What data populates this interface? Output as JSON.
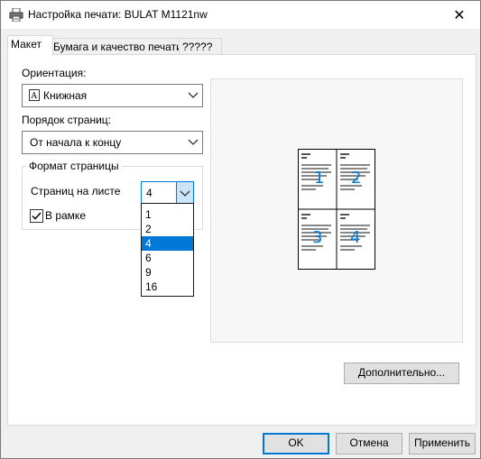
{
  "window": {
    "title": "Настройка печати: BULAT M1121nw",
    "close_glyph": "✕"
  },
  "tabs": [
    {
      "label": "Макет",
      "active": true
    },
    {
      "label": "Бумага и качество печати",
      "active": false
    },
    {
      "label": "?????",
      "active": false
    }
  ],
  "orientation": {
    "label": "Ориентация:",
    "value": "Книжная"
  },
  "page_order": {
    "label": "Порядок страниц:",
    "value": "От начала к концу"
  },
  "page_format": {
    "title": "Формат страницы",
    "pages_per_sheet_label": "Страниц на листе",
    "pages_per_sheet_value": "4",
    "border_label": "В рамке",
    "border_checked": true
  },
  "pages_dropdown": {
    "options": [
      "1",
      "2",
      "4",
      "6",
      "9",
      "16"
    ],
    "selected": "4"
  },
  "preview": {
    "page_numbers": [
      "1",
      "2",
      "3",
      "4"
    ]
  },
  "buttons": {
    "advanced": "Дополнительно...",
    "ok": "OK",
    "cancel": "Отмена",
    "apply": "Применить"
  },
  "colors": {
    "accent": "#0078d7",
    "window_bg": "#f0f0f0"
  }
}
